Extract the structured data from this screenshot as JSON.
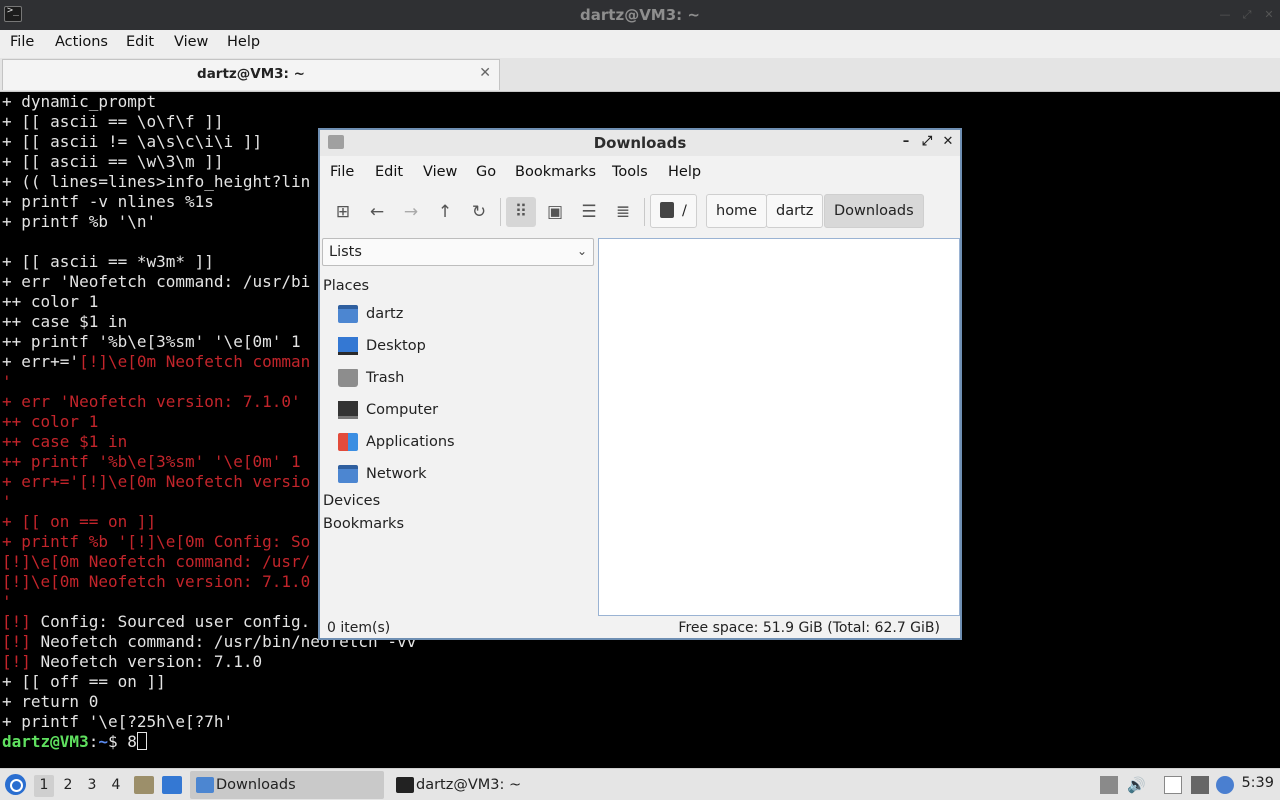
{
  "terminal": {
    "title": "dartz@VM3: ~",
    "menu": [
      "File",
      "Actions",
      "Edit",
      "View",
      "Help"
    ],
    "tab_label": "dartz@VM3: ~",
    "tab_close": "✕",
    "lines": [
      "+ dynamic_prompt",
      "+ [[ ascii == \\o\\f\\f ]]",
      "+ [[ ascii != \\a\\s\\c\\i\\i ]]",
      "+ [[ ascii == \\w\\3\\m ]]",
      "+ (( lines=lines>info_height?lin",
      "+ printf -v nlines %1s",
      "+ printf %b '\\n'",
      "",
      "+ [[ ascii == *w3m* ]]",
      "+ err 'Neofetch command: /usr/bi",
      "++ color 1",
      "++ case $1 in",
      "++ printf '%b\\e[3%sm' '\\e[0m' 1"
    ],
    "line_err_prefix": "+ err+='",
    "line_err_red": "[!]\\e[0m Neofetch comman",
    "red_lines": [
      "'",
      "+ err 'Neofetch version: 7.1.0'",
      "++ color 1",
      "++ case $1 in",
      "++ printf '%b\\e[3%sm' '\\e[0m' 1",
      "+ err+='[!]\\e[0m Neofetch versio",
      "'",
      "+ [[ on == on ]]",
      "+ printf %b '[!]\\e[0m Config: So",
      "[!]\\e[0m Neofetch command: /usr/",
      "[!]\\e[0m Neofetch version: 7.1.0",
      "'"
    ],
    "out_lines": [
      {
        "tag": "[!]",
        "text": " Config: Sourced user config."
      },
      {
        "tag": "[!]",
        "text": " Neofetch command: /usr/bin/neofetch -vv"
      },
      {
        "tag": "[!]",
        "text": " Neofetch version: 7.1.0"
      }
    ],
    "tail_lines": [
      "+ [[ off == on ]]",
      "+ return 0",
      "+ printf '\\e[?25h\\e[?7h'"
    ],
    "prompt_user": "dartz@VM3",
    "prompt_sep": ":",
    "prompt_path": "~",
    "prompt_tail": "$ 8"
  },
  "file_manager": {
    "title": "Downloads",
    "menu": [
      "File",
      "Edit",
      "View",
      "Go",
      "Bookmarks",
      "Tools",
      "Help"
    ],
    "breadcrumbs": [
      "/",
      "home",
      "dartz",
      "Downloads"
    ],
    "side_select": "Lists",
    "places_heading": "Places",
    "places": [
      "dartz",
      "Desktop",
      "Trash",
      "Computer",
      "Applications",
      "Network"
    ],
    "devices_heading": "Devices",
    "bookmarks_heading": "Bookmarks",
    "status_count": "0 item(s)",
    "status_free": "Free space: 51.9 GiB (Total: 62.7 GiB)"
  },
  "taskbar": {
    "workspaces": [
      "1",
      "2",
      "3",
      "4"
    ],
    "tasks": [
      "Downloads",
      "dartz@VM3: ~"
    ],
    "clock": "5:39"
  }
}
